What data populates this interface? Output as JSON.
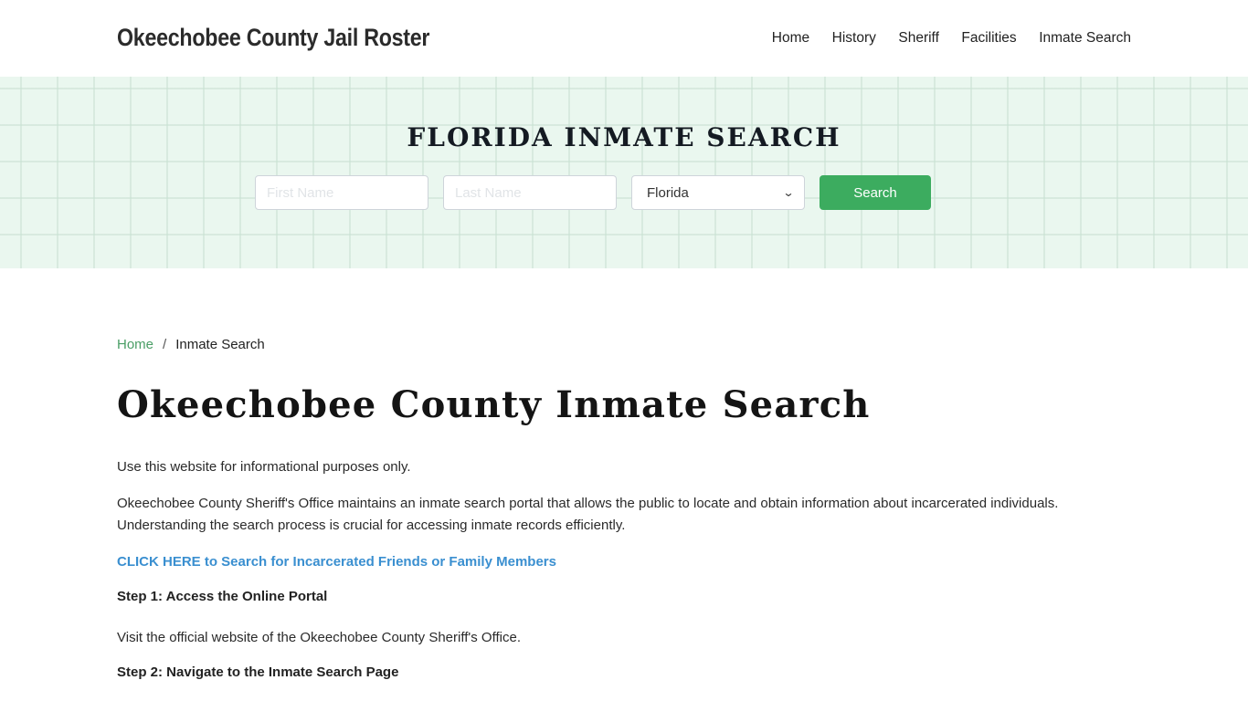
{
  "header": {
    "brand": "Okeechobee County Jail Roster",
    "nav": [
      "Home",
      "History",
      "Sheriff",
      "Facilities",
      "Inmate Search"
    ]
  },
  "hero": {
    "title": "FLORIDA INMATE SEARCH",
    "first_name_placeholder": "First Name",
    "last_name_placeholder": "Last Name",
    "first_name_value": "",
    "last_name_value": "",
    "state_selected": "Florida",
    "search_label": "Search"
  },
  "breadcrumb": {
    "home": "Home",
    "separator": "/",
    "current": "Inmate Search"
  },
  "main": {
    "title": "Okeechobee County Inmate Search",
    "intro": "Use this website for informational purposes only.",
    "paragraph": "Okeechobee County Sheriff's Office maintains an inmate search portal that allows the public to locate and obtain information about incarcerated individuals. Understanding the search process is crucial for accessing inmate records efficiently.",
    "cta_link": "CLICK HERE to Search for Incarcerated Friends or Family Members",
    "step1_heading": "Step 1: Access the Online Portal",
    "step1_text": "Visit the official website of the Okeechobee County Sheriff's Office.",
    "step2_heading": "Step 2: Navigate to the Inmate Search Page"
  },
  "colors": {
    "accent_green": "#3cac5f",
    "breadcrumb_link": "#4a9e66",
    "cta_link": "#3a8fd0",
    "hero_bg": "#eaf7ef"
  }
}
